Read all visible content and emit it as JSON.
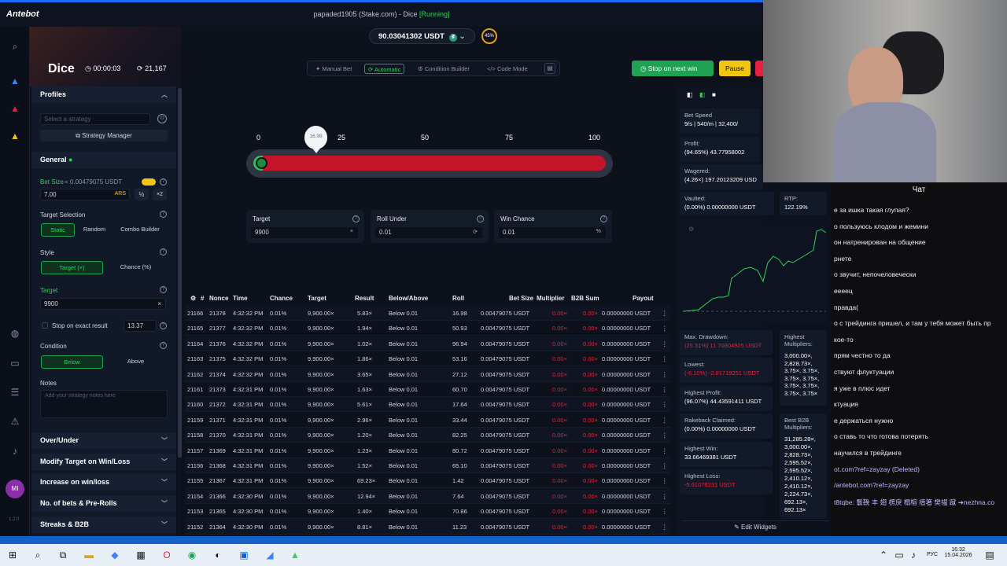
{
  "app": {
    "logo": "Antebot",
    "window_title": "papaded1905 (Stake.com) - Dice ",
    "status": "[Running]"
  },
  "header": {
    "game_title": "Dice",
    "timer": "00:00:03",
    "bet_counter": "21,167",
    "balance": "90.03041302 USDT",
    "token_symbol": "₮",
    "progress_badge": "45%",
    "modes": [
      "Manual Bet",
      "Automatic",
      "Condition Builder",
      "Code Mode"
    ],
    "active_mode": "Automatic",
    "stop_label": "Stop on next win",
    "pause_label": "Pause"
  },
  "sidebar": {
    "profiles_label": "Profiles",
    "strategy_placeholder": "Select a strategy",
    "strategy_manager_label": "Strategy Manager",
    "general_label": "General",
    "bet_size_label": "Bet Size",
    "bet_size_usdt": "= 0.00479075 USDT",
    "bet_size_value": "7.00",
    "bet_currency": "ARS",
    "half": "½",
    "double": "×2",
    "target_selection_label": "Target Selection",
    "target_selection_options": [
      "Static",
      "Random",
      "Combo Builder"
    ],
    "style_label": "Style",
    "style_options": [
      "Target (×)",
      "Chance (%)"
    ],
    "target_label": "Target",
    "target_value": "9900",
    "clear": "×",
    "stop_exact_label": "Stop on exact result",
    "stop_exact_value": "13.37",
    "condition_label": "Condition",
    "condition_options": [
      "Below",
      "Above"
    ],
    "notes_label": "Notes",
    "notes_placeholder": "Add your strategy notes here",
    "sections": [
      "Over/Under",
      "Modify Target on Win/Loss",
      "Increase on win/loss",
      "No. of bets & Pre-Rolls",
      "Streaks & B2B"
    ],
    "version": "1.2.0",
    "avatar": "MI"
  },
  "slider": {
    "ticks": [
      "0",
      "25",
      "50",
      "75",
      "100"
    ],
    "marker": "16.98",
    "roll_under": 0.01
  },
  "fields": [
    {
      "label": "Target",
      "value": "9900",
      "suffix": "×"
    },
    {
      "label": "Roll Under",
      "value": "0.01",
      "suffix": "⟳"
    },
    {
      "label": "Win Chance",
      "value": "0.01",
      "suffix": "%"
    }
  ],
  "table": {
    "headers": [
      "#",
      "Nonce",
      "Time",
      "Chance",
      "Target",
      "Result",
      "Below/Above",
      "Roll",
      "Bet Size",
      "Multiplier",
      "B2B Sum",
      "Payout"
    ],
    "rows": [
      [
        "21166",
        "21378",
        "4:32:32 PM",
        "0.01%",
        "9,900.00×",
        "5.83×",
        "Below 0.01",
        "16.98",
        "0.00479075 USDT",
        "0.00×",
        "0.00×",
        "0.00000000 USDT"
      ],
      [
        "21165",
        "21377",
        "4:32:32 PM",
        "0.01%",
        "9,900.00×",
        "1.94×",
        "Below 0.01",
        "50.93",
        "0.00479075 USDT",
        "0.00×",
        "0.00×",
        "0.00000000 USDT"
      ],
      [
        "21164",
        "21376",
        "4:32:32 PM",
        "0.01%",
        "9,900.00×",
        "1.02×",
        "Below 0.01",
        "96.94",
        "0.00479075 USDT",
        "0.00×",
        "0.00×",
        "0.00000000 USDT"
      ],
      [
        "21163",
        "21375",
        "4:32:32 PM",
        "0.01%",
        "9,900.00×",
        "1.86×",
        "Below 0.01",
        "53.16",
        "0.00479075 USDT",
        "0.00×",
        "0.00×",
        "0.00000000 USDT"
      ],
      [
        "21162",
        "21374",
        "4:32:32 PM",
        "0.01%",
        "9,900.00×",
        "3.65×",
        "Below 0.01",
        "27.12",
        "0.00479075 USDT",
        "0.00×",
        "0.00×",
        "0.00000000 USDT"
      ],
      [
        "21161",
        "21373",
        "4:32:31 PM",
        "0.01%",
        "9,900.00×",
        "1.63×",
        "Below 0.01",
        "60.70",
        "0.00479075 USDT",
        "0.00×",
        "0.00×",
        "0.00000000 USDT"
      ],
      [
        "21160",
        "21372",
        "4:32:31 PM",
        "0.01%",
        "9,900.00×",
        "5.61×",
        "Below 0.01",
        "17.64",
        "0.00479075 USDT",
        "0.00×",
        "0.00×",
        "0.00000000 USDT"
      ],
      [
        "21159",
        "21371",
        "4:32:31 PM",
        "0.01%",
        "9,900.00×",
        "2.96×",
        "Below 0.01",
        "33.44",
        "0.00479075 USDT",
        "0.00×",
        "0.00×",
        "0.00000000 USDT"
      ],
      [
        "21158",
        "21370",
        "4:32:31 PM",
        "0.01%",
        "9,900.00×",
        "1.20×",
        "Below 0.01",
        "82.25",
        "0.00479075 USDT",
        "0.00×",
        "0.00×",
        "0.00000000 USDT"
      ],
      [
        "21157",
        "21369",
        "4:32:31 PM",
        "0.01%",
        "9,900.00×",
        "1.23×",
        "Below 0.01",
        "80.72",
        "0.00479075 USDT",
        "0.00×",
        "0.00×",
        "0.00000000 USDT"
      ],
      [
        "21156",
        "21368",
        "4:32:31 PM",
        "0.01%",
        "9,900.00×",
        "1.52×",
        "Below 0.01",
        "65.10",
        "0.00479075 USDT",
        "0.00×",
        "0.00×",
        "0.00000000 USDT"
      ],
      [
        "21155",
        "21367",
        "4:32:31 PM",
        "0.01%",
        "9,900.00×",
        "69.23×",
        "Below 0.01",
        "1.42",
        "0.00479075 USDT",
        "0.00×",
        "0.00×",
        "0.00000000 USDT"
      ],
      [
        "21154",
        "21366",
        "4:32:30 PM",
        "0.01%",
        "9,900.00×",
        "12.94×",
        "Below 0.01",
        "7.64",
        "0.00479075 USDT",
        "0.00×",
        "0.00×",
        "0.00000000 USDT"
      ],
      [
        "21153",
        "21365",
        "4:32:30 PM",
        "0.01%",
        "9,900.00×",
        "1.40×",
        "Below 0.01",
        "70.86",
        "0.00479075 USDT",
        "0.00×",
        "0.00×",
        "0.00000000 USDT"
      ],
      [
        "21152",
        "21364",
        "4:32:30 PM",
        "0.01%",
        "9,900.00×",
        "8.81×",
        "Below 0.01",
        "11.23",
        "0.00479075 USDT",
        "0.00×",
        "0.00×",
        "0.00000000 USDT"
      ]
    ]
  },
  "stats": {
    "bet_speed_label": "Bet Speed",
    "bet_speed": "9/s | 540/m | 32,400/",
    "profit_label": "Profit:",
    "profit": "(94.65%) 43.77958002",
    "wagered_label": "Wagered:",
    "wagered": "(4.26×) 197.20123209 USD",
    "vaulted_label": "Vaulted:",
    "vaulted": "(0.00%) 0.00000000 USDT",
    "rtp_label": "RTP:",
    "rtp": "122.19%",
    "max_drawdown_label": "Max. Drawdown:",
    "max_drawdown": "(25.31%) 11.70804925 USDT",
    "lowest_label": "Lowest:",
    "lowest": "(-6.10%) -2.81719251 USDT",
    "highest_profit_label": "Highest Profit:",
    "highest_profit": "(96.07%) 44.43591411 USDT",
    "rakeback_label": "Rakeback Claimed:",
    "rakeback": "(0.00%) 0.00000000 USDT",
    "highest_win_label": "Highest Win:",
    "highest_win": "33.66469381 USDT",
    "highest_loss_label": "Highest Loss:",
    "highest_loss": "-5.61078231 USDT",
    "highest_multipliers_label": "Highest Multipliers:",
    "highest_multipliers": [
      "3,000.00×,",
      "2,828.73×,",
      "3.75×, 3.75×,",
      "3.75×, 3.75×,",
      "3.75×, 3.75×,",
      "3.75×, 3.75×"
    ],
    "best_b2b_label": "Best B2B Multipliers:",
    "best_b2b": [
      "31,285.28×,",
      "3,000.00×,",
      "2,828.73×,",
      "2,595.52×,",
      "2,595.52×,",
      "2,410.12×,",
      "2,410.12×,",
      "2,224.73×,",
      "692.13×,",
      "692.13×"
    ],
    "edit_widgets": "Edit Widgets"
  },
  "chat": {
    "title": "Чат",
    "messages": [
      "е за ишка такая глупая?",
      "о пользуюсь клодом и жемини",
      "он натренирован на общение",
      "рнете",
      "о звучит, непочеловечески",
      "еееец",
      "правда(",
      "о с трейдинга пришел, и там у тебя может быть пр",
      "кое-то",
      "прям честно то да",
      "ствуют флуктуации",
      "я уже в плюс идет",
      "ктуация",
      "е держаться нужно",
      "о ставь то что готова потерять",
      "научился в трейдинге",
      "ot.com?ref=zayzay (Deleted)",
      "/antebot.com?ref=zayzay",
      "t8tqbe: 鬟鞔 丰 翅 楞戾 榻榕 瘖箸 樊韫 蹴 ➔nezhna.co"
    ]
  },
  "taskbar": {
    "time": "16:32",
    "date": "15.04.2026",
    "lang": "РУС"
  },
  "colors": {
    "accent_green": "#1fa353",
    "accent_red": "#c3142a",
    "accent_yellow": "#f3c513"
  }
}
